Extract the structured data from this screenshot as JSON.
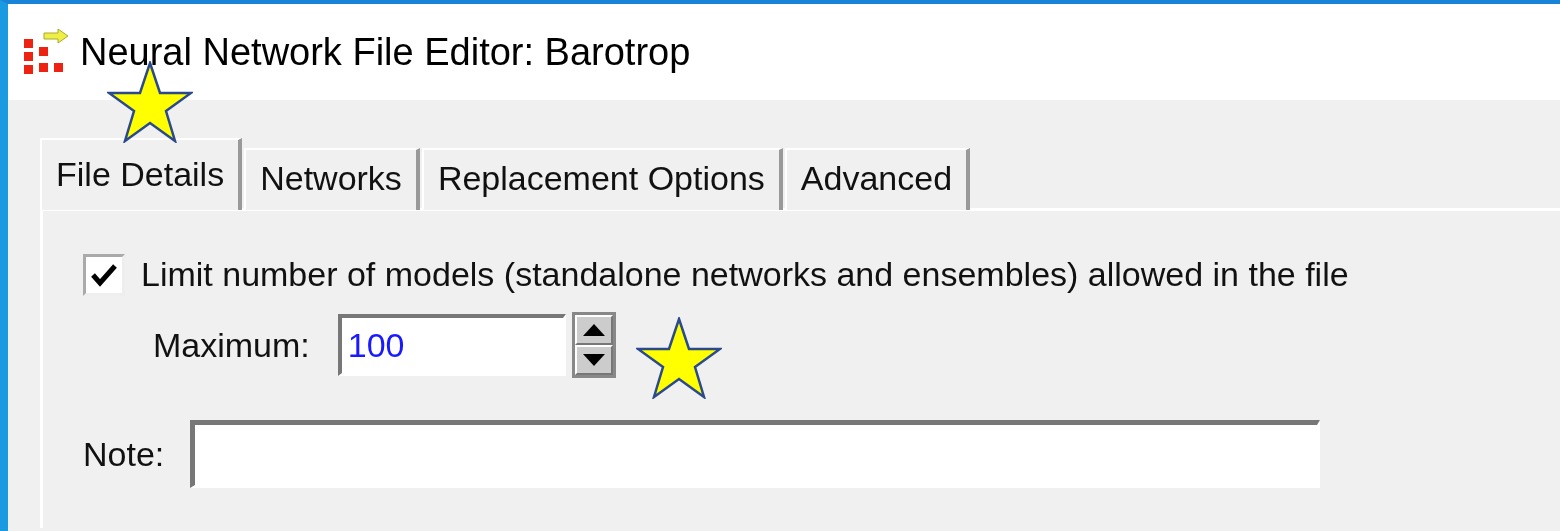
{
  "window": {
    "title": "Neural Network File Editor: Barotrop"
  },
  "tabs": [
    {
      "label": "File Details",
      "selected": true
    },
    {
      "label": "Networks",
      "selected": false
    },
    {
      "label": "Replacement Options",
      "selected": false
    },
    {
      "label": "Advanced",
      "selected": false
    }
  ],
  "limit_models": {
    "label": "Limit number of models (standalone networks and ensembles) allowed in the file",
    "checked": true
  },
  "maximum": {
    "label": "Maximum:",
    "value": "100"
  },
  "note": {
    "label": "Note:"
  }
}
